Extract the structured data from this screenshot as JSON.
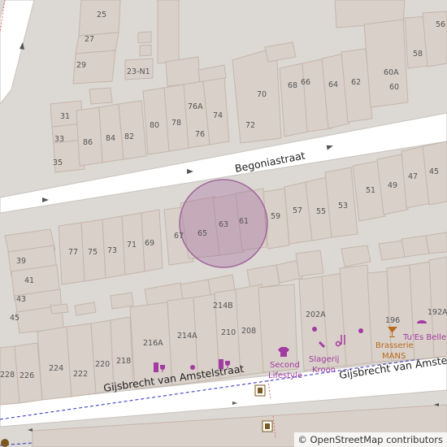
{
  "streets": {
    "begonia": "Begoniastraat",
    "gijsbrecht_left": "Gijsbrecht van Amstelstraat",
    "gijsbrecht_right": "Gijsbrecht van Amstelstraat"
  },
  "house_numbers": {
    "n25": "25",
    "n27": "27",
    "n29": "29",
    "n23n1": "23-N1",
    "n31": "31",
    "n33": "33",
    "n35": "35",
    "n86": "86",
    "n84": "84",
    "n82": "82",
    "n80": "80",
    "n78": "78",
    "n76a": "76A",
    "n76": "76",
    "n74": "74",
    "n70": "70",
    "n72": "72",
    "n68": "68",
    "n66": "66",
    "n64": "64",
    "n62": "62",
    "n60a": "60A",
    "n60": "60",
    "n58": "58",
    "n56": "56",
    "n77": "77",
    "n75": "75",
    "n73": "73",
    "n71": "71",
    "n69": "69",
    "n67": "67",
    "n65": "65",
    "n63": "63",
    "n61": "61",
    "n59": "59",
    "n57": "57",
    "n55": "55",
    "n53": "53",
    "n51": "51",
    "n49": "49",
    "n47": "47",
    "n45r": "45",
    "n39": "39",
    "n41": "41",
    "n43": "43",
    "n45": "45",
    "n214b": "214B",
    "n202a": "202A",
    "n196": "196",
    "n192a": "192A",
    "n216a": "216A",
    "n214a": "214A",
    "n210": "210",
    "n208": "208",
    "n224": "224",
    "n222": "222",
    "n220": "220",
    "n218": "218",
    "n228": "228",
    "n226": "226"
  },
  "pois": {
    "tues_belle": "Tu'Es Belle",
    "brasserie_1": "Brasserie",
    "brasserie_2": "MANS",
    "slagerij_1": "Slagerij",
    "slagerij_2": "Kroon",
    "second_1": "Second",
    "second_2": "Lifestyle"
  },
  "attribution": {
    "symbol": "©",
    "text": "OpenStreetMap contributors"
  },
  "colors": {
    "building": "#d9d0c9",
    "road": "#ffffff",
    "highlight": "#a0679b",
    "poi_shop": "#a23ba2",
    "poi_food": "#b86a1e",
    "bus_route": "#1a1ab0"
  },
  "icons": [
    "arrow-icon",
    "wine-shop-icon",
    "clothes-shop-icon",
    "butcher-icon",
    "hairdresser-icon",
    "cocktail-bar-icon",
    "beauty-icon",
    "parking-ticket-icon"
  ]
}
